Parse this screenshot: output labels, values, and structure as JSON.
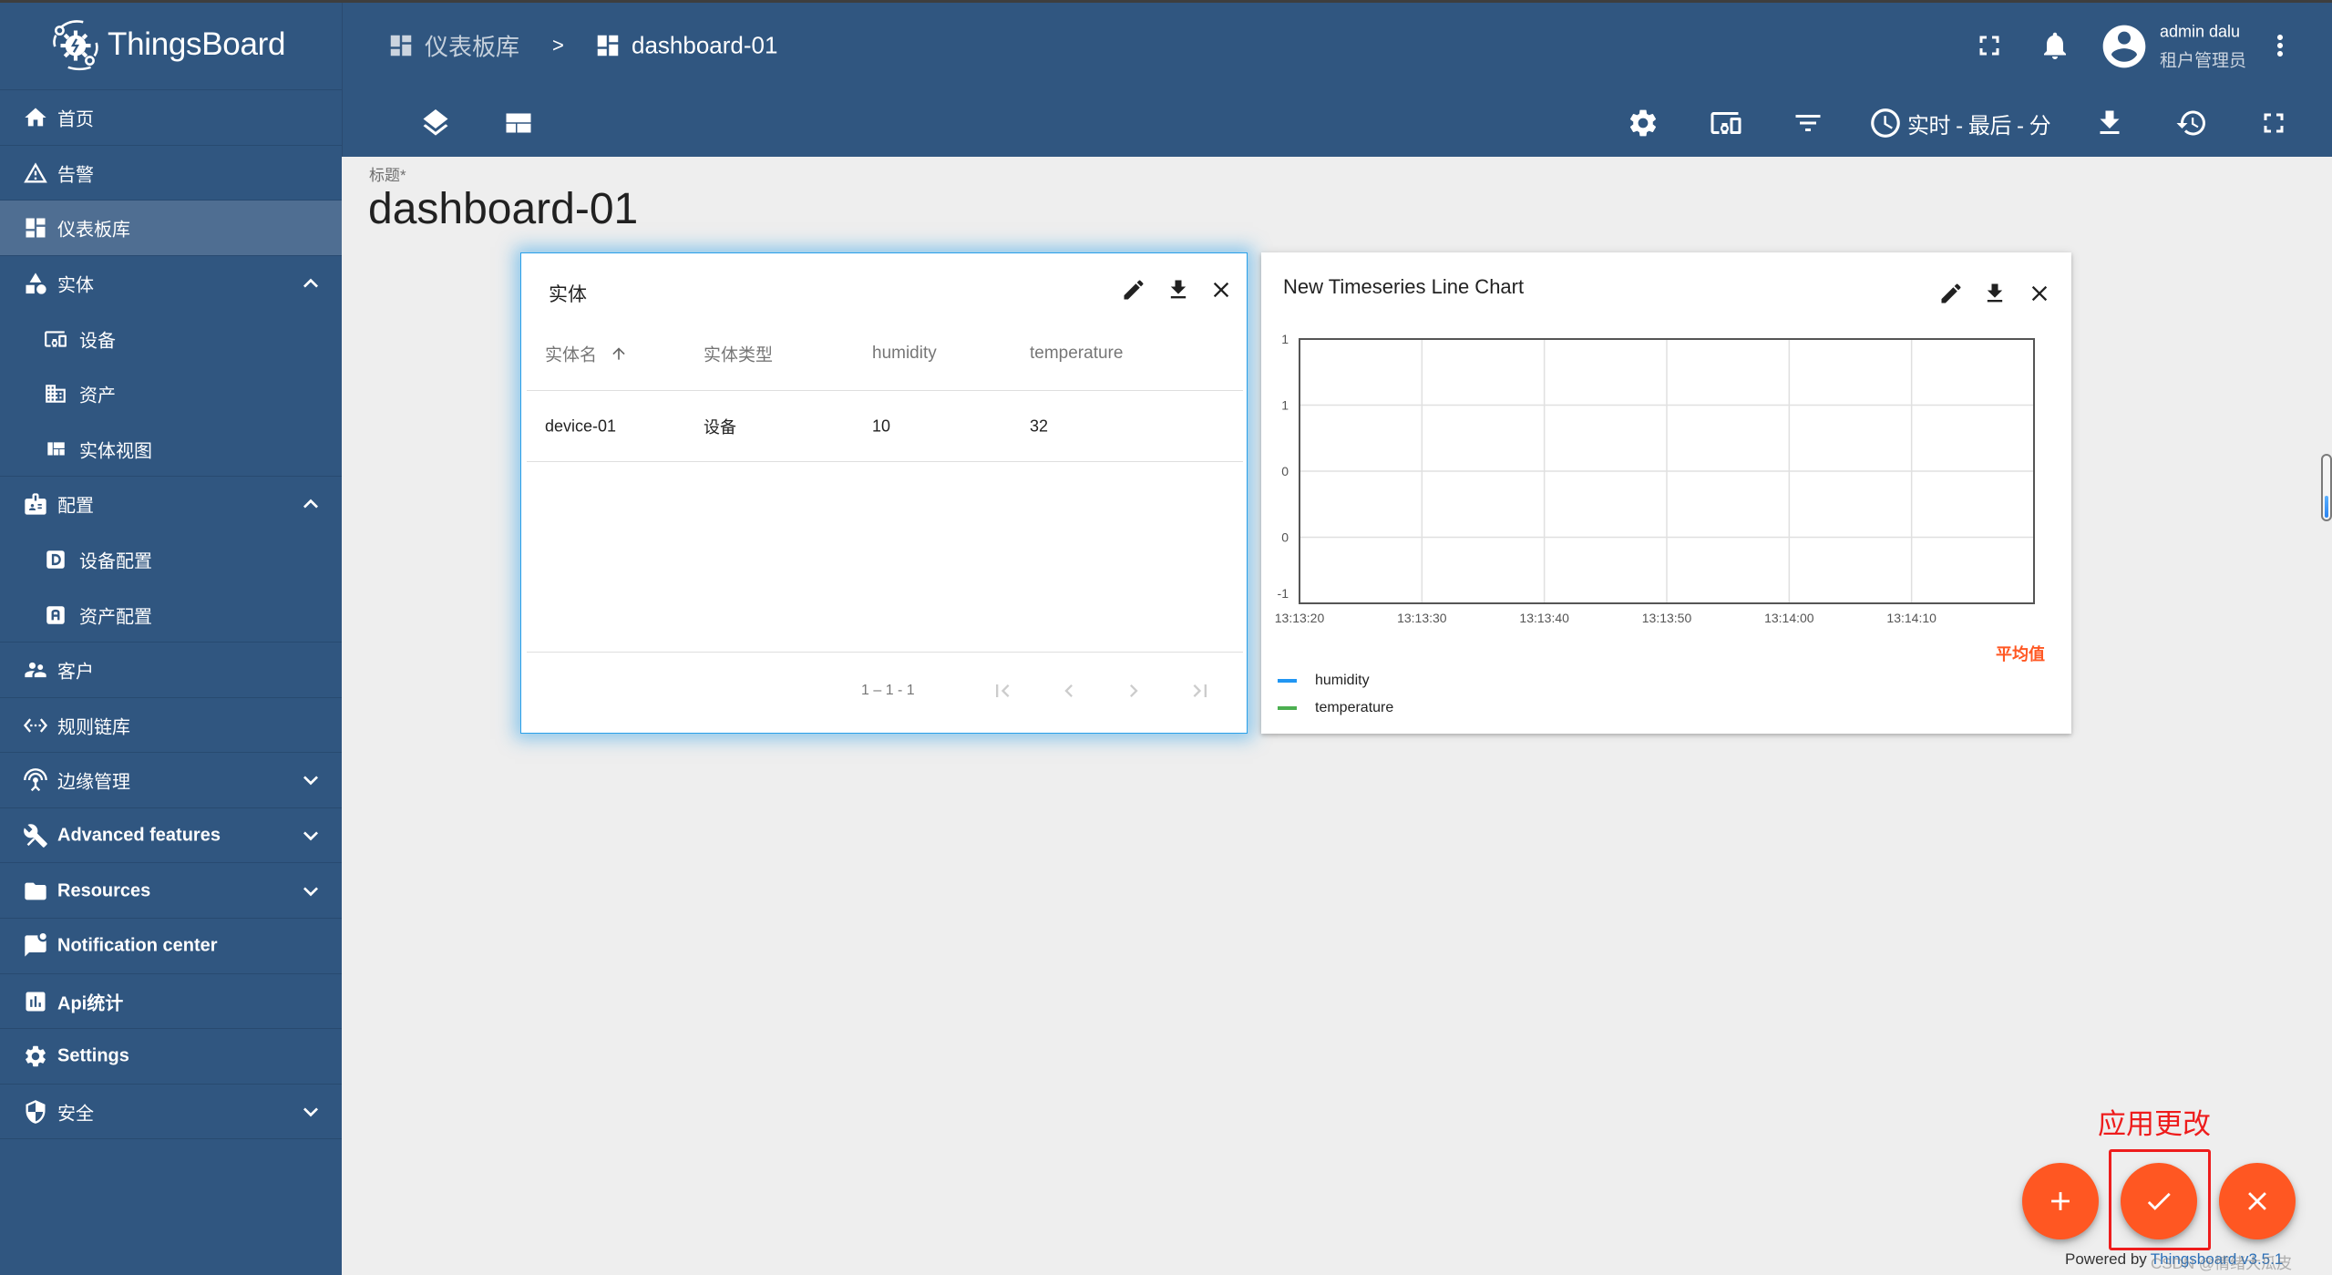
{
  "colors": {
    "primary": "#305680",
    "primary_light": "#4f6e92",
    "accent": "#ff5722",
    "annotation": "#ee1c1c",
    "widget_highlight": "#29a0ea"
  },
  "app": {
    "name": "ThingsBoard"
  },
  "sidebar": {
    "items": [
      {
        "label": "首页",
        "icon": "home-icon"
      },
      {
        "label": "告警",
        "icon": "warning-icon"
      },
      {
        "label": "仪表板库",
        "icon": "dashboards-icon",
        "selected": true
      },
      {
        "label": "实体",
        "icon": "category-icon",
        "expanded": true,
        "children": [
          {
            "label": "设备",
            "icon": "devices-icon"
          },
          {
            "label": "资产",
            "icon": "domain-icon"
          },
          {
            "label": "实体视图",
            "icon": "view-quilt-icon"
          }
        ]
      },
      {
        "label": "配置",
        "icon": "badge-icon",
        "expanded": true,
        "children": [
          {
            "label": "设备配置",
            "icon": "device-profile-icon"
          },
          {
            "label": "资产配置",
            "icon": "asset-profile-icon"
          }
        ]
      },
      {
        "label": "客户",
        "icon": "customers-icon"
      },
      {
        "label": "规则链库",
        "icon": "rule-chain-icon"
      },
      {
        "label": "边缘管理",
        "icon": "edge-icon",
        "expanded": false
      },
      {
        "label": "Advanced features",
        "icon": "construction-icon",
        "expanded": false
      },
      {
        "label": "Resources",
        "icon": "folder-icon",
        "expanded": false
      },
      {
        "label": "Notification center",
        "icon": "notification-center-icon"
      },
      {
        "label": "Api统计",
        "icon": "api-usage-icon"
      },
      {
        "label": "Settings",
        "icon": "settings-icon"
      },
      {
        "label": "安全",
        "icon": "security-icon",
        "expanded": false
      }
    ]
  },
  "header": {
    "breadcrumb": [
      {
        "label": "仪表板库",
        "icon": "dashboards-icon"
      },
      {
        "label": "dashboard-01",
        "icon": "dashboard-icon"
      }
    ],
    "breadcrumb_separator": ">",
    "user": {
      "name": "admin dalu",
      "role": "租户管理员"
    },
    "timewindow": "实时 - 最后 - 分"
  },
  "dashboard": {
    "title_label": "标题*",
    "title": "dashboard-01"
  },
  "entities_widget": {
    "title": "实体",
    "columns": [
      {
        "label": "实体名",
        "sort": "asc"
      },
      {
        "label": "实体类型"
      },
      {
        "label": "humidity"
      },
      {
        "label": "temperature"
      }
    ],
    "rows": [
      {
        "cells": [
          "device-01",
          "设备",
          "10",
          "32"
        ]
      }
    ],
    "paginator": "1 – 1 - 1"
  },
  "chart_widget": {
    "title": "New Timeseries Line Chart",
    "legend_header": "平均值"
  },
  "chart_data": {
    "type": "line",
    "title": "New Timeseries Line Chart",
    "xlabel": "",
    "ylabel": "",
    "xlim": [
      "13:13:20",
      "13:14:20"
    ],
    "xticks": [
      "13:13:20",
      "13:13:30",
      "13:13:40",
      "13:13:50",
      "13:14:00",
      "13:14:10"
    ],
    "ylim": [
      -1,
      1
    ],
    "yticks": [
      {
        "value": 1,
        "label": "1"
      },
      {
        "value": 0.5,
        "label": "1"
      },
      {
        "value": 0,
        "label": "0"
      },
      {
        "value": -0.5,
        "label": "0"
      },
      {
        "value": -1,
        "label": "-1"
      }
    ],
    "grid": true,
    "legend": "bottom-left",
    "legend_columns": [
      "平均值"
    ],
    "series": [
      {
        "name": "humidity",
        "color": "#2196f3",
        "points": []
      },
      {
        "name": "temperature",
        "color": "#4caf50",
        "points": []
      }
    ]
  },
  "fab": {
    "buttons": [
      "add-icon",
      "check-icon",
      "close-icon"
    ]
  },
  "annotation": {
    "label": "应用更改"
  },
  "footer": {
    "powered_by": "Powered by",
    "link": "Thingsboard v3.5.1",
    "watermark": "CSDN @情绪大瓜皮"
  },
  "side_slider": {
    "value": 0.4
  }
}
